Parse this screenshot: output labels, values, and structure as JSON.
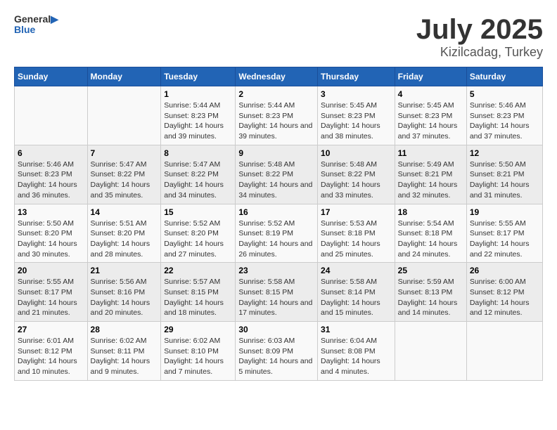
{
  "logo": {
    "text_general": "General",
    "text_blue": "Blue"
  },
  "title": {
    "month_year": "July 2025",
    "location": "Kizilcadag, Turkey"
  },
  "days_of_week": [
    "Sunday",
    "Monday",
    "Tuesday",
    "Wednesday",
    "Thursday",
    "Friday",
    "Saturday"
  ],
  "weeks": [
    [
      {
        "day": "",
        "sunrise": "",
        "sunset": "",
        "daylight": ""
      },
      {
        "day": "",
        "sunrise": "",
        "sunset": "",
        "daylight": ""
      },
      {
        "day": "1",
        "sunrise": "Sunrise: 5:44 AM",
        "sunset": "Sunset: 8:23 PM",
        "daylight": "Daylight: 14 hours and 39 minutes."
      },
      {
        "day": "2",
        "sunrise": "Sunrise: 5:44 AM",
        "sunset": "Sunset: 8:23 PM",
        "daylight": "Daylight: 14 hours and 39 minutes."
      },
      {
        "day": "3",
        "sunrise": "Sunrise: 5:45 AM",
        "sunset": "Sunset: 8:23 PM",
        "daylight": "Daylight: 14 hours and 38 minutes."
      },
      {
        "day": "4",
        "sunrise": "Sunrise: 5:45 AM",
        "sunset": "Sunset: 8:23 PM",
        "daylight": "Daylight: 14 hours and 37 minutes."
      },
      {
        "day": "5",
        "sunrise": "Sunrise: 5:46 AM",
        "sunset": "Sunset: 8:23 PM",
        "daylight": "Daylight: 14 hours and 37 minutes."
      }
    ],
    [
      {
        "day": "6",
        "sunrise": "Sunrise: 5:46 AM",
        "sunset": "Sunset: 8:23 PM",
        "daylight": "Daylight: 14 hours and 36 minutes."
      },
      {
        "day": "7",
        "sunrise": "Sunrise: 5:47 AM",
        "sunset": "Sunset: 8:22 PM",
        "daylight": "Daylight: 14 hours and 35 minutes."
      },
      {
        "day": "8",
        "sunrise": "Sunrise: 5:47 AM",
        "sunset": "Sunset: 8:22 PM",
        "daylight": "Daylight: 14 hours and 34 minutes."
      },
      {
        "day": "9",
        "sunrise": "Sunrise: 5:48 AM",
        "sunset": "Sunset: 8:22 PM",
        "daylight": "Daylight: 14 hours and 34 minutes."
      },
      {
        "day": "10",
        "sunrise": "Sunrise: 5:48 AM",
        "sunset": "Sunset: 8:22 PM",
        "daylight": "Daylight: 14 hours and 33 minutes."
      },
      {
        "day": "11",
        "sunrise": "Sunrise: 5:49 AM",
        "sunset": "Sunset: 8:21 PM",
        "daylight": "Daylight: 14 hours and 32 minutes."
      },
      {
        "day": "12",
        "sunrise": "Sunrise: 5:50 AM",
        "sunset": "Sunset: 8:21 PM",
        "daylight": "Daylight: 14 hours and 31 minutes."
      }
    ],
    [
      {
        "day": "13",
        "sunrise": "Sunrise: 5:50 AM",
        "sunset": "Sunset: 8:20 PM",
        "daylight": "Daylight: 14 hours and 30 minutes."
      },
      {
        "day": "14",
        "sunrise": "Sunrise: 5:51 AM",
        "sunset": "Sunset: 8:20 PM",
        "daylight": "Daylight: 14 hours and 28 minutes."
      },
      {
        "day": "15",
        "sunrise": "Sunrise: 5:52 AM",
        "sunset": "Sunset: 8:20 PM",
        "daylight": "Daylight: 14 hours and 27 minutes."
      },
      {
        "day": "16",
        "sunrise": "Sunrise: 5:52 AM",
        "sunset": "Sunset: 8:19 PM",
        "daylight": "Daylight: 14 hours and 26 minutes."
      },
      {
        "day": "17",
        "sunrise": "Sunrise: 5:53 AM",
        "sunset": "Sunset: 8:18 PM",
        "daylight": "Daylight: 14 hours and 25 minutes."
      },
      {
        "day": "18",
        "sunrise": "Sunrise: 5:54 AM",
        "sunset": "Sunset: 8:18 PM",
        "daylight": "Daylight: 14 hours and 24 minutes."
      },
      {
        "day": "19",
        "sunrise": "Sunrise: 5:55 AM",
        "sunset": "Sunset: 8:17 PM",
        "daylight": "Daylight: 14 hours and 22 minutes."
      }
    ],
    [
      {
        "day": "20",
        "sunrise": "Sunrise: 5:55 AM",
        "sunset": "Sunset: 8:17 PM",
        "daylight": "Daylight: 14 hours and 21 minutes."
      },
      {
        "day": "21",
        "sunrise": "Sunrise: 5:56 AM",
        "sunset": "Sunset: 8:16 PM",
        "daylight": "Daylight: 14 hours and 20 minutes."
      },
      {
        "day": "22",
        "sunrise": "Sunrise: 5:57 AM",
        "sunset": "Sunset: 8:15 PM",
        "daylight": "Daylight: 14 hours and 18 minutes."
      },
      {
        "day": "23",
        "sunrise": "Sunrise: 5:58 AM",
        "sunset": "Sunset: 8:15 PM",
        "daylight": "Daylight: 14 hours and 17 minutes."
      },
      {
        "day": "24",
        "sunrise": "Sunrise: 5:58 AM",
        "sunset": "Sunset: 8:14 PM",
        "daylight": "Daylight: 14 hours and 15 minutes."
      },
      {
        "day": "25",
        "sunrise": "Sunrise: 5:59 AM",
        "sunset": "Sunset: 8:13 PM",
        "daylight": "Daylight: 14 hours and 14 minutes."
      },
      {
        "day": "26",
        "sunrise": "Sunrise: 6:00 AM",
        "sunset": "Sunset: 8:12 PM",
        "daylight": "Daylight: 14 hours and 12 minutes."
      }
    ],
    [
      {
        "day": "27",
        "sunrise": "Sunrise: 6:01 AM",
        "sunset": "Sunset: 8:12 PM",
        "daylight": "Daylight: 14 hours and 10 minutes."
      },
      {
        "day": "28",
        "sunrise": "Sunrise: 6:02 AM",
        "sunset": "Sunset: 8:11 PM",
        "daylight": "Daylight: 14 hours and 9 minutes."
      },
      {
        "day": "29",
        "sunrise": "Sunrise: 6:02 AM",
        "sunset": "Sunset: 8:10 PM",
        "daylight": "Daylight: 14 hours and 7 minutes."
      },
      {
        "day": "30",
        "sunrise": "Sunrise: 6:03 AM",
        "sunset": "Sunset: 8:09 PM",
        "daylight": "Daylight: 14 hours and 5 minutes."
      },
      {
        "day": "31",
        "sunrise": "Sunrise: 6:04 AM",
        "sunset": "Sunset: 8:08 PM",
        "daylight": "Daylight: 14 hours and 4 minutes."
      },
      {
        "day": "",
        "sunrise": "",
        "sunset": "",
        "daylight": ""
      },
      {
        "day": "",
        "sunrise": "",
        "sunset": "",
        "daylight": ""
      }
    ]
  ]
}
